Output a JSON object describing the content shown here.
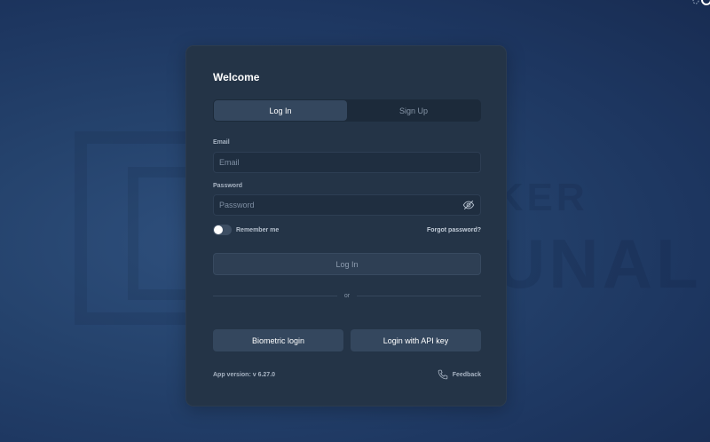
{
  "card": {
    "title": "Welcome",
    "tabs": [
      {
        "label": "Log In",
        "active": true
      },
      {
        "label": "Sign Up",
        "active": false
      }
    ],
    "email": {
      "label": "Email",
      "placeholder": "Email",
      "value": ""
    },
    "password": {
      "label": "Password",
      "placeholder": "Password",
      "value": "",
      "icon": "eye-off-icon"
    },
    "remember_me": {
      "label": "Remember me",
      "checked": false
    },
    "forgot_password": "Forgot password?",
    "login_button": "Log In",
    "divider_text": "or",
    "alt_buttons": {
      "biometric": "Biometric login",
      "api_key": "Login with API key"
    },
    "app_version": "App version: v 6.27.0",
    "feedback": {
      "label": "Feedback",
      "icon": "phone-icon"
    }
  },
  "background_watermark": {
    "line1": "BROKER",
    "line2": "TRIBUNAL"
  },
  "colors": {
    "background": "#25436d",
    "card": "#243447",
    "active_tab": "#34475e",
    "input": "#1f2e40"
  }
}
